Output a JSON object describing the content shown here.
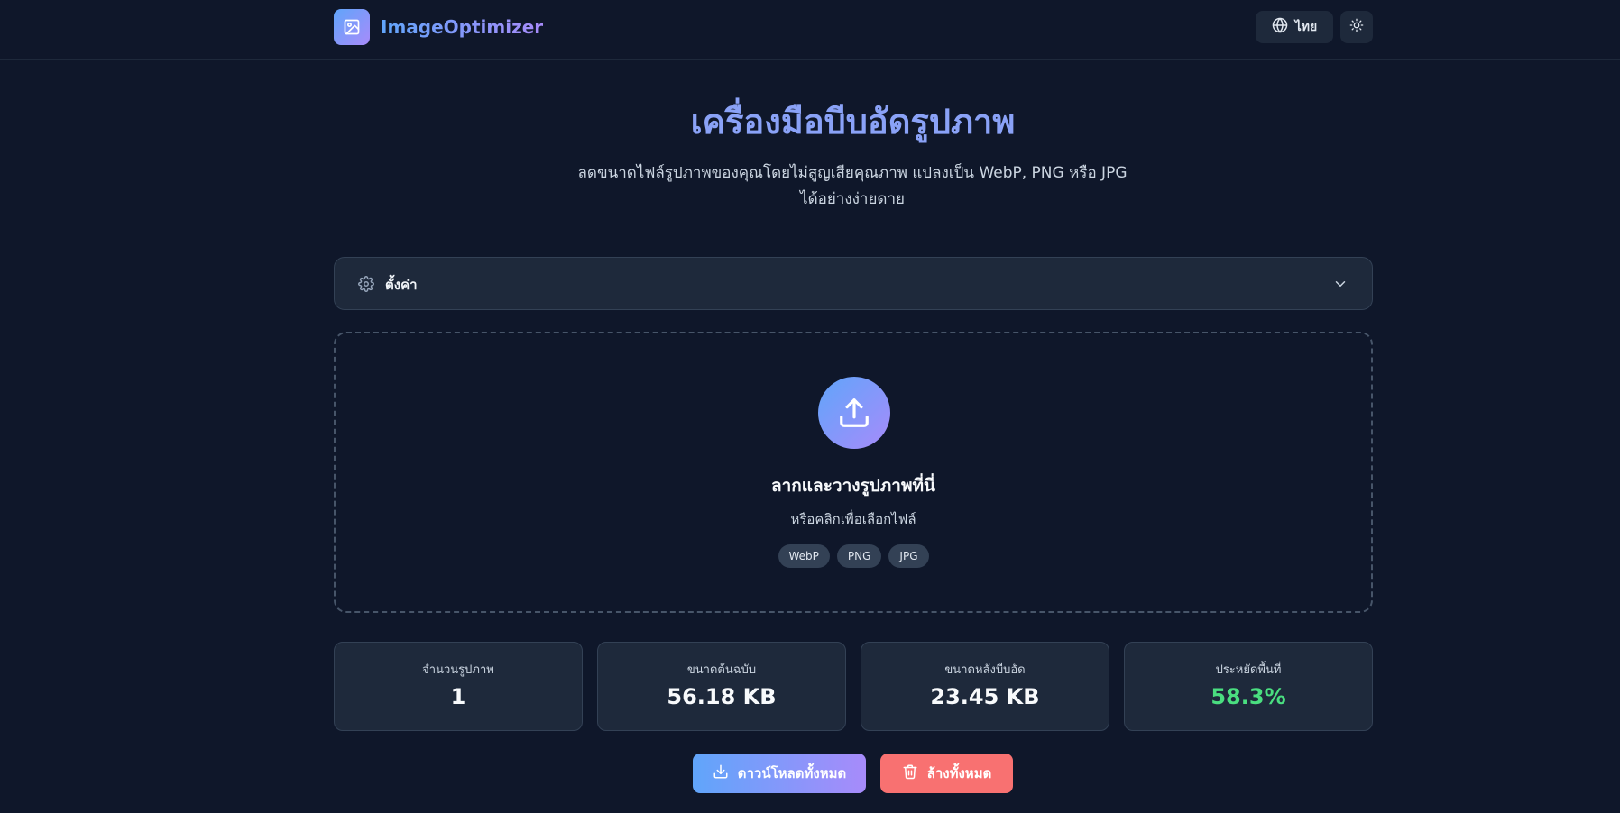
{
  "header": {
    "brand_name": "ImageOptimizer",
    "language_label": "ไทย",
    "icons": {
      "logo": "image-icon",
      "language": "globe-icon",
      "theme": "sun-icon"
    }
  },
  "hero": {
    "title": "เครื่องมือบีบอัดรูปภาพ",
    "subtitle_line1": "ลดขนาดไฟล์รูปภาพของคุณโดยไม่สูญเสียคุณภาพ แปลงเป็น WebP, PNG หรือ JPG",
    "subtitle_line2": "ได้อย่างง่ายดาย"
  },
  "settings": {
    "label": "ตั้งค่า",
    "icons": {
      "gear": "gear-icon",
      "chevron": "chevron-down-icon"
    }
  },
  "dropzone": {
    "title": "ลากและวางรูปภาพที่นี่",
    "subtitle": "หรือคลิกเพื่อเลือกไฟล์",
    "formats": [
      "WebP",
      "PNG",
      "JPG"
    ],
    "icon": "upload-icon"
  },
  "stats": [
    {
      "label": "จำนวนรูปภาพ",
      "value": "1"
    },
    {
      "label": "ขนาดต้นฉบับ",
      "value": "56.18 KB"
    },
    {
      "label": "ขนาดหลังบีบอัด",
      "value": "23.45 KB"
    },
    {
      "label": "ประหยัดพื้นที่",
      "value": "58.3%"
    }
  ],
  "actions": {
    "download_all": "ดาวน์โหลดทั้งหมด",
    "clear_all": "ล้างทั้งหมด"
  },
  "colors": {
    "background": "#0f172a",
    "card": "#1e293b",
    "accent_start": "#60a5fa",
    "accent_end": "#a78bfa",
    "success": "#4ade80",
    "danger": "#f87171"
  }
}
